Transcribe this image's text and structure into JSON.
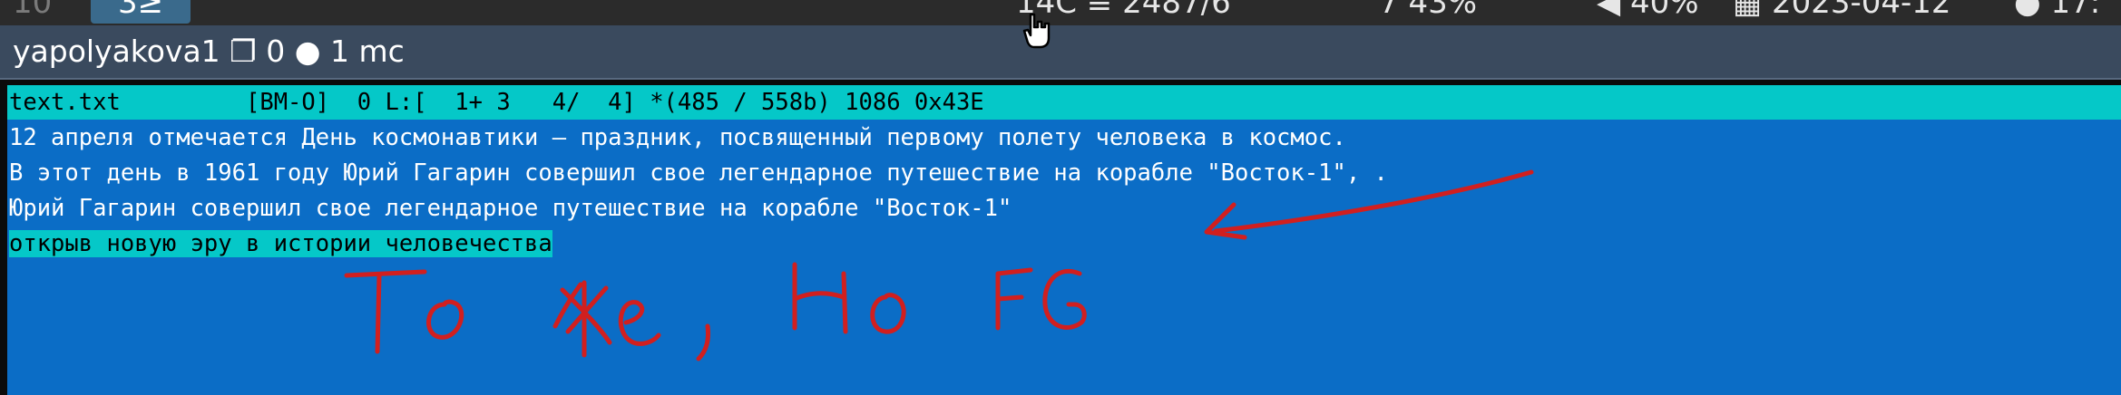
{
  "topbar": {
    "workspace_inactive": "10",
    "workspace_active": "3≥",
    "mem": "14C ≡ 2487/6",
    "disk": "7 43%",
    "volume": "40%",
    "date": "2023-04-12",
    "time": "17:"
  },
  "window": {
    "title": "yapolyakova1 ❐ 0 ● 1 mc"
  },
  "editor": {
    "status_line": "text.txt         [BM-O]  0 L:[  1+ 3   4/  4] *(485 / 558b) 1086 0x43E",
    "lines": [
      "12 апреля отмечается День космонавтики – праздник, посвященный первому полету человека в космос.",
      "В этот день в 1961 году Юрий Гагарин совершил свое легендарное путешествие на корабле \"Восток-1\", .",
      "Юрий Гагарин совершил свое легендарное путешествие на корабле \"Восток-1\"",
      "открыв новую эру в истории человечества"
    ]
  },
  "annotation": {
    "handwritten_text": "То же, но FG",
    "ink_color": "#d11f1f"
  },
  "colors": {
    "editor_bg": "#0b6dc6",
    "status_bg": "#05c8c8",
    "titlebar_bg": "#3a4a5e"
  }
}
